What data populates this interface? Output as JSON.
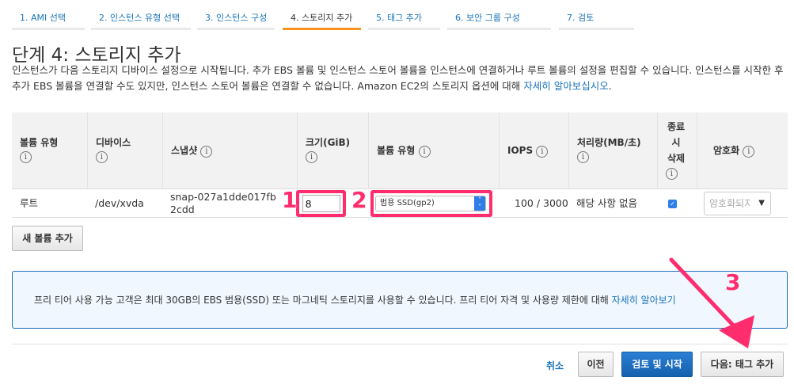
{
  "tabs": [
    "1. AMI 선택",
    "2. 인스턴스 유형 선택",
    "3. 인스턴스 구성",
    "4. 스토리지 추가",
    "5. 태그 추가",
    "6. 보안 그룹 구성",
    "7. 검토"
  ],
  "active_tab": 3,
  "title": "단계 4: 스토리지 추가",
  "description": "인스턴스가 다음 스토리지 디바이스 설정으로 시작됩니다. 추가 EBS 볼륨 및 인스턴스 스토어 볼륨을 인스턴스에 연결하거나 루트 볼륨의 설정을 편집할 수 있습니다. 인스턴스를 시작한 후 추가 EBS 볼륨을 연결할 수도 있지만, 인스턴스 스토어 볼륨은 연결할 수 없습니다. Amazon EC2의 스토리지 옵션에 대해 ",
  "description_link": "자세히 알아보십시오",
  "columns": [
    "볼륨 유형",
    "디바이스",
    "스냅샷",
    "크기(GiB)",
    "볼륨 유형",
    "IOPS",
    "처리량(MB/초)",
    "종료 시 삭제",
    "암호화"
  ],
  "row": {
    "volume_kind": "루트",
    "device": "/dev/xvda",
    "snapshot": "snap-027a1dde017fb2cdd",
    "size": "8",
    "volume_type": "범용 SSD(gp2)",
    "iops": "100 / 3000",
    "throughput": "해당 사항 없음",
    "delete_on_termination": true,
    "encryption_placeholder": "암호화되지"
  },
  "add_volume": "새 볼륨 추가",
  "notice": "프리 티어 사용 가능 고객은 최대 30GB의 EBS 범용(SSD) 또는 마그네틱 스토리지를 사용할 수 있습니다. 프리 티어 자격 및 사용량 제한에 대해 ",
  "notice_link": "자세히 알아보기",
  "footer": {
    "cancel": "취소",
    "previous": "이전",
    "review_launch": "검토 및 시작",
    "next": "다음: 태그 추가"
  },
  "annotations": [
    "1",
    "2",
    "3"
  ],
  "colors": {
    "accent": "#f7941d",
    "link": "#1a73b8",
    "annotation": "#ff2d6e",
    "primary": "#1a6cc0"
  }
}
